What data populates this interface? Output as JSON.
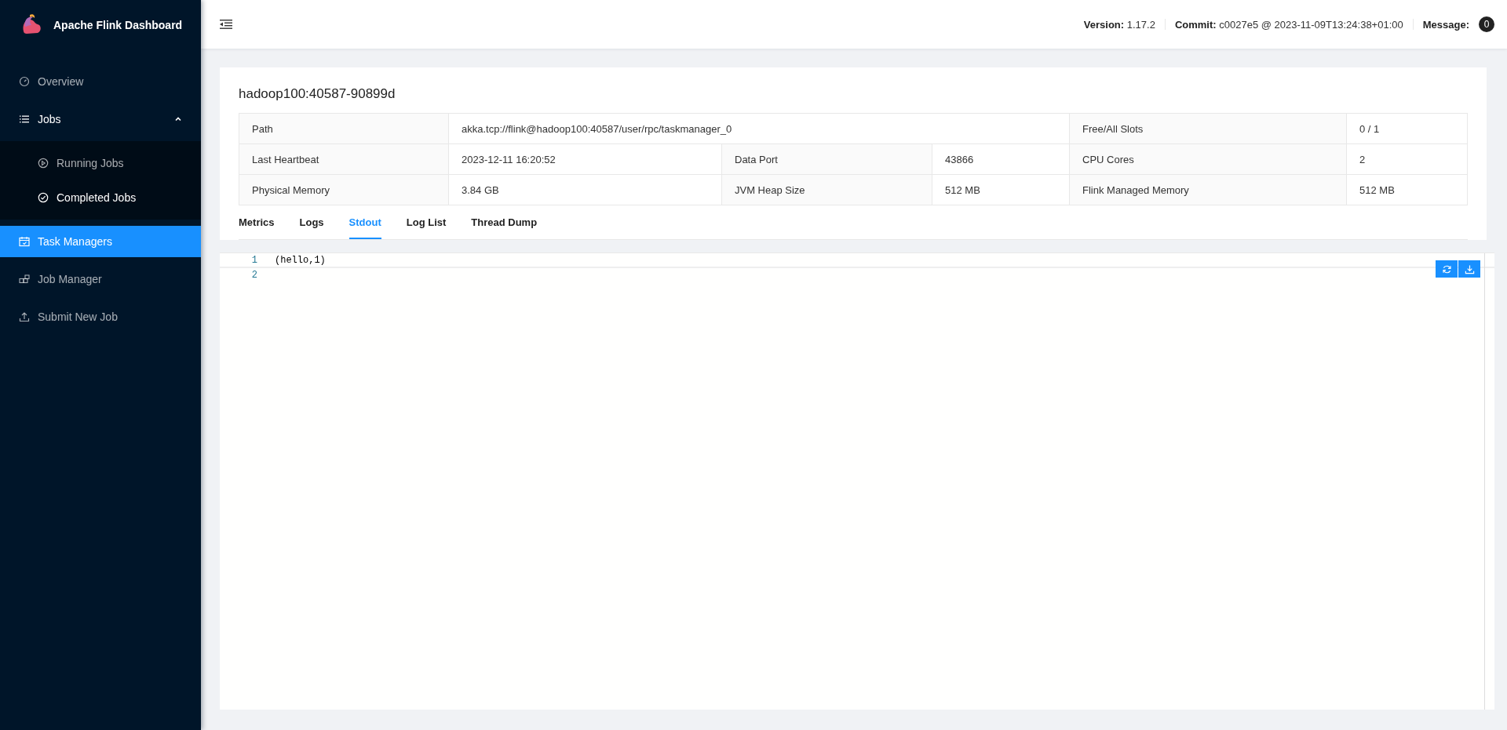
{
  "sidebar": {
    "brand": "Apache Flink Dashboard",
    "items": [
      {
        "label": "Overview",
        "selected": false
      },
      {
        "label": "Jobs",
        "selected": false,
        "expanded": true,
        "children": [
          {
            "label": "Running Jobs",
            "selected": false
          },
          {
            "label": "Completed Jobs",
            "selected": false
          }
        ]
      },
      {
        "label": "Task Managers",
        "selected": true
      },
      {
        "label": "Job Manager",
        "selected": false
      },
      {
        "label": "Submit New Job",
        "selected": false
      }
    ]
  },
  "header": {
    "version_label": "Version:",
    "version": "1.17.2",
    "commit_label": "Commit:",
    "commit": "c0027e5 @ 2023-11-09T13:24:38+01:00",
    "message_label": "Message:",
    "message_count": "0"
  },
  "taskmanager": {
    "title": "hadoop100:40587-90899d",
    "rows": [
      [
        "Path",
        {
          "text": "akka.tcp://flink@hadoop100:40587/user/rpc/taskmanager_0",
          "colspan": 3
        },
        "Free/All Slots",
        "0 / 1"
      ],
      [
        "Last Heartbeat",
        "2023-12-11 16:20:52",
        "Data Port",
        "43866",
        "CPU Cores",
        "2"
      ],
      [
        "Physical Memory",
        "3.84 GB",
        "JVM Heap Size",
        "512 MB",
        "Flink Managed Memory",
        "512 MB"
      ]
    ]
  },
  "tabs": [
    {
      "label": "Metrics",
      "selected": false
    },
    {
      "label": "Logs",
      "selected": false
    },
    {
      "label": "Stdout",
      "selected": true
    },
    {
      "label": "Log List",
      "selected": false
    },
    {
      "label": "Thread Dump",
      "selected": false
    }
  ],
  "editor": {
    "lines": [
      {
        "number": "1",
        "text": "(hello,1)",
        "current": true
      },
      {
        "number": "2",
        "current": false
      }
    ]
  }
}
